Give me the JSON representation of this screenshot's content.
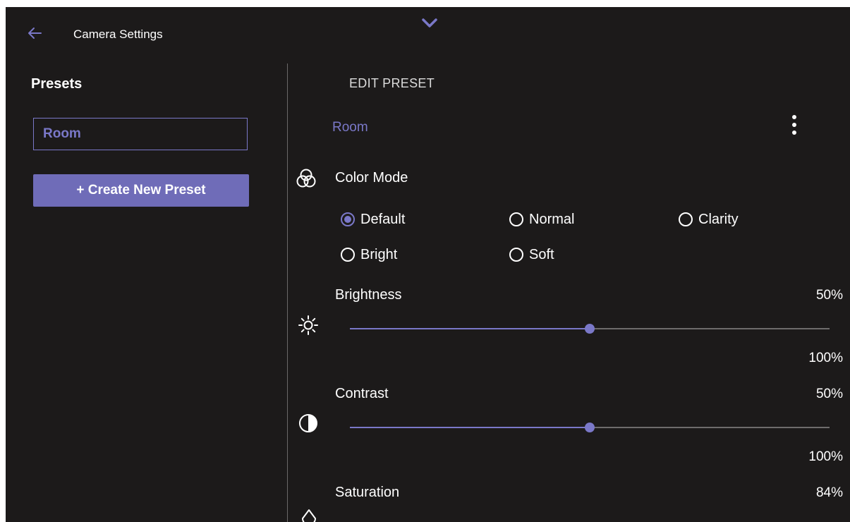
{
  "header": {
    "title": "Camera Settings"
  },
  "sidebar": {
    "heading": "Presets",
    "presets": [
      {
        "label": "Room"
      }
    ],
    "create_label": "+ Create New Preset"
  },
  "editor": {
    "title": "EDIT PRESET",
    "preset_name": "Room",
    "color_mode": {
      "label": "Color Mode",
      "options": [
        "Default",
        "Normal",
        "Clarity",
        "Bright",
        "Soft"
      ],
      "selected": "Default"
    },
    "brightness": {
      "label": "Brightness",
      "value_label": "50%",
      "max_label": "100%",
      "level": 0.5
    },
    "contrast": {
      "label": "Contrast",
      "value_label": "50%",
      "max_label": "100%",
      "level": 0.5
    },
    "saturation": {
      "label": "Saturation",
      "value_label": "84%"
    }
  },
  "colors": {
    "accent": "#7a78c8",
    "background": "#1c1a1a",
    "button": "#6f6cb8"
  },
  "icons": [
    "back-arrow-icon",
    "chevron-down-icon",
    "more-vertical-icon",
    "color-circles-icon",
    "sun-icon",
    "contrast-icon",
    "droplet-icon"
  ]
}
